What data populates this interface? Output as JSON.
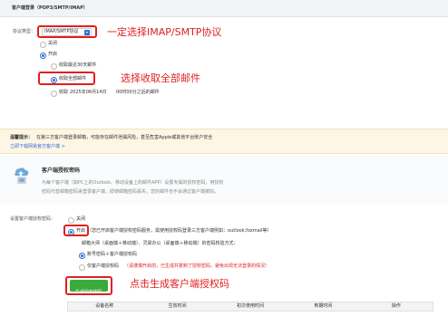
{
  "header": {
    "title": "客户端登录（POP3/SMTP/IMAP）"
  },
  "protocol": {
    "label": "协议类型：",
    "selected": "IMAP/SMTP协议",
    "annotation": "一定选择IMAP/SMTP协议"
  },
  "client_login": {
    "off_label": "关闭",
    "on_label": "开启",
    "recent_30": "收取最近30天邮件",
    "all_mail": "收取全部邮件",
    "since_prefix": "收取",
    "since_date": "2025年08月14日",
    "since_suffix": "00时00分之后的邮件",
    "annotation": "选择收取全部邮件"
  },
  "notice": {
    "label": "温馨提示：",
    "text": "在第三方客户端登录邮箱，可能存在邮件泄漏风险，甚至危害Apple或其他平台账户安全",
    "link": "立即下载网易官方客户端 >"
  },
  "auth": {
    "title": "客户端授权密码",
    "desc1": "为每个客户端（如PC上的Outlook、移动设备上的邮件APP）设置专属的授权密码，用授权",
    "desc2": "密码代替邮箱密码来登录客户端，即使邮箱密码丢失，您的邮件也不会通过客户端被窃。"
  },
  "settings": {
    "label": "设置客户端授权密码：",
    "off_label": "关闭",
    "on_label": "开启",
    "on_desc": "（您已开启客户端授权密码服务，需使用授权码登录三方客户端例如：outlook,foxmail等）",
    "hint": "邮箱大师（桌面端＋移动端）、灵犀办公（桌面端＋移动端）的密码校验方式：",
    "opt1": "账号密码＋客户端授权码",
    "opt2": "仅客户端授权码",
    "opt2_warn": "（请谨慎开启前，已生成并复制了授权密码，避免出现无法登录的情况）",
    "generate_button": "生成授权密码",
    "annotation": "点击生成客户端授权码"
  },
  "table": {
    "columns": [
      "设备名称",
      "生效时间",
      "初次使用时间",
      "到期时间",
      "操作"
    ]
  },
  "colors": {
    "accent": "#2f6fd6",
    "annotation_red": "#e02020",
    "button_green": "#3aab3a",
    "warn_red": "#e02020"
  }
}
